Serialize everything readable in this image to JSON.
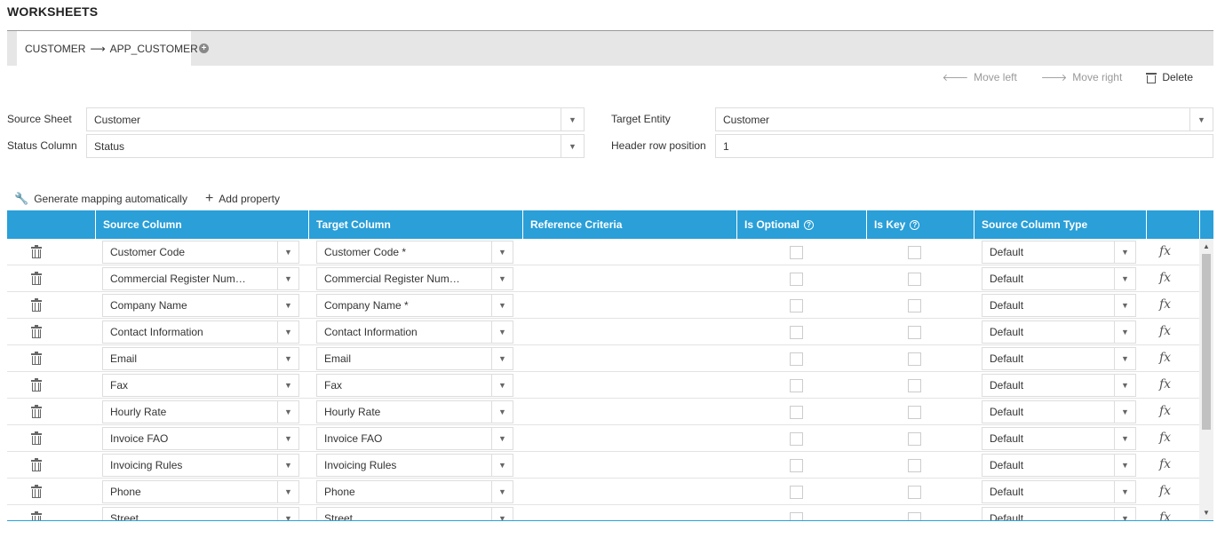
{
  "page": {
    "title": "WORKSHEETS"
  },
  "tabs": [
    {
      "source": "CUSTOMER",
      "arrow": "⟶",
      "target": "APP_CUSTOMER"
    }
  ],
  "tab_add_icon": "plus-circle-icon",
  "worksheet_actions": {
    "move_left": "Move left",
    "move_right": "Move right",
    "delete": "Delete"
  },
  "form": {
    "source_sheet_label": "Source Sheet",
    "source_sheet_value": "Customer",
    "status_column_label": "Status Column",
    "status_column_value": "Status",
    "target_entity_label": "Target Entity",
    "target_entity_value": "Customer",
    "header_row_label": "Header row position",
    "header_row_value": "1"
  },
  "toolbar": {
    "generate_label": "Generate mapping automatically",
    "add_property_label": "Add property"
  },
  "grid": {
    "headers": {
      "source_column": "Source Column",
      "target_column": "Target Column",
      "reference_criteria": "Reference Criteria",
      "is_optional": "Is Optional",
      "is_key": "Is Key",
      "source_column_type": "Source Column Type"
    },
    "formula_icon": "fx",
    "rows": [
      {
        "source": "Customer Code",
        "target": "Customer Code *",
        "optional": false,
        "key": false,
        "type": "Default"
      },
      {
        "source": "Commercial Register Num…",
        "target": "Commercial Register Num…",
        "optional": false,
        "key": false,
        "type": "Default"
      },
      {
        "source": "Company Name",
        "target": "Company Name *",
        "optional": false,
        "key": false,
        "type": "Default"
      },
      {
        "source": "Contact Information",
        "target": "Contact Information",
        "optional": false,
        "key": false,
        "type": "Default"
      },
      {
        "source": "Email",
        "target": "Email",
        "optional": false,
        "key": false,
        "type": "Default"
      },
      {
        "source": "Fax",
        "target": "Fax",
        "optional": false,
        "key": false,
        "type": "Default"
      },
      {
        "source": "Hourly Rate",
        "target": "Hourly Rate",
        "optional": false,
        "key": false,
        "type": "Default"
      },
      {
        "source": "Invoice FAO",
        "target": "Invoice FAO",
        "optional": false,
        "key": false,
        "type": "Default"
      },
      {
        "source": "Invoicing Rules",
        "target": "Invoicing Rules",
        "optional": false,
        "key": false,
        "type": "Default"
      },
      {
        "source": "Phone",
        "target": "Phone",
        "optional": false,
        "key": false,
        "type": "Default"
      },
      {
        "source": "Street",
        "target": "Street",
        "optional": false,
        "key": false,
        "type": "Default"
      }
    ]
  },
  "colors": {
    "accent": "#2a9fd8",
    "tabbar": "#e6e6e6"
  }
}
